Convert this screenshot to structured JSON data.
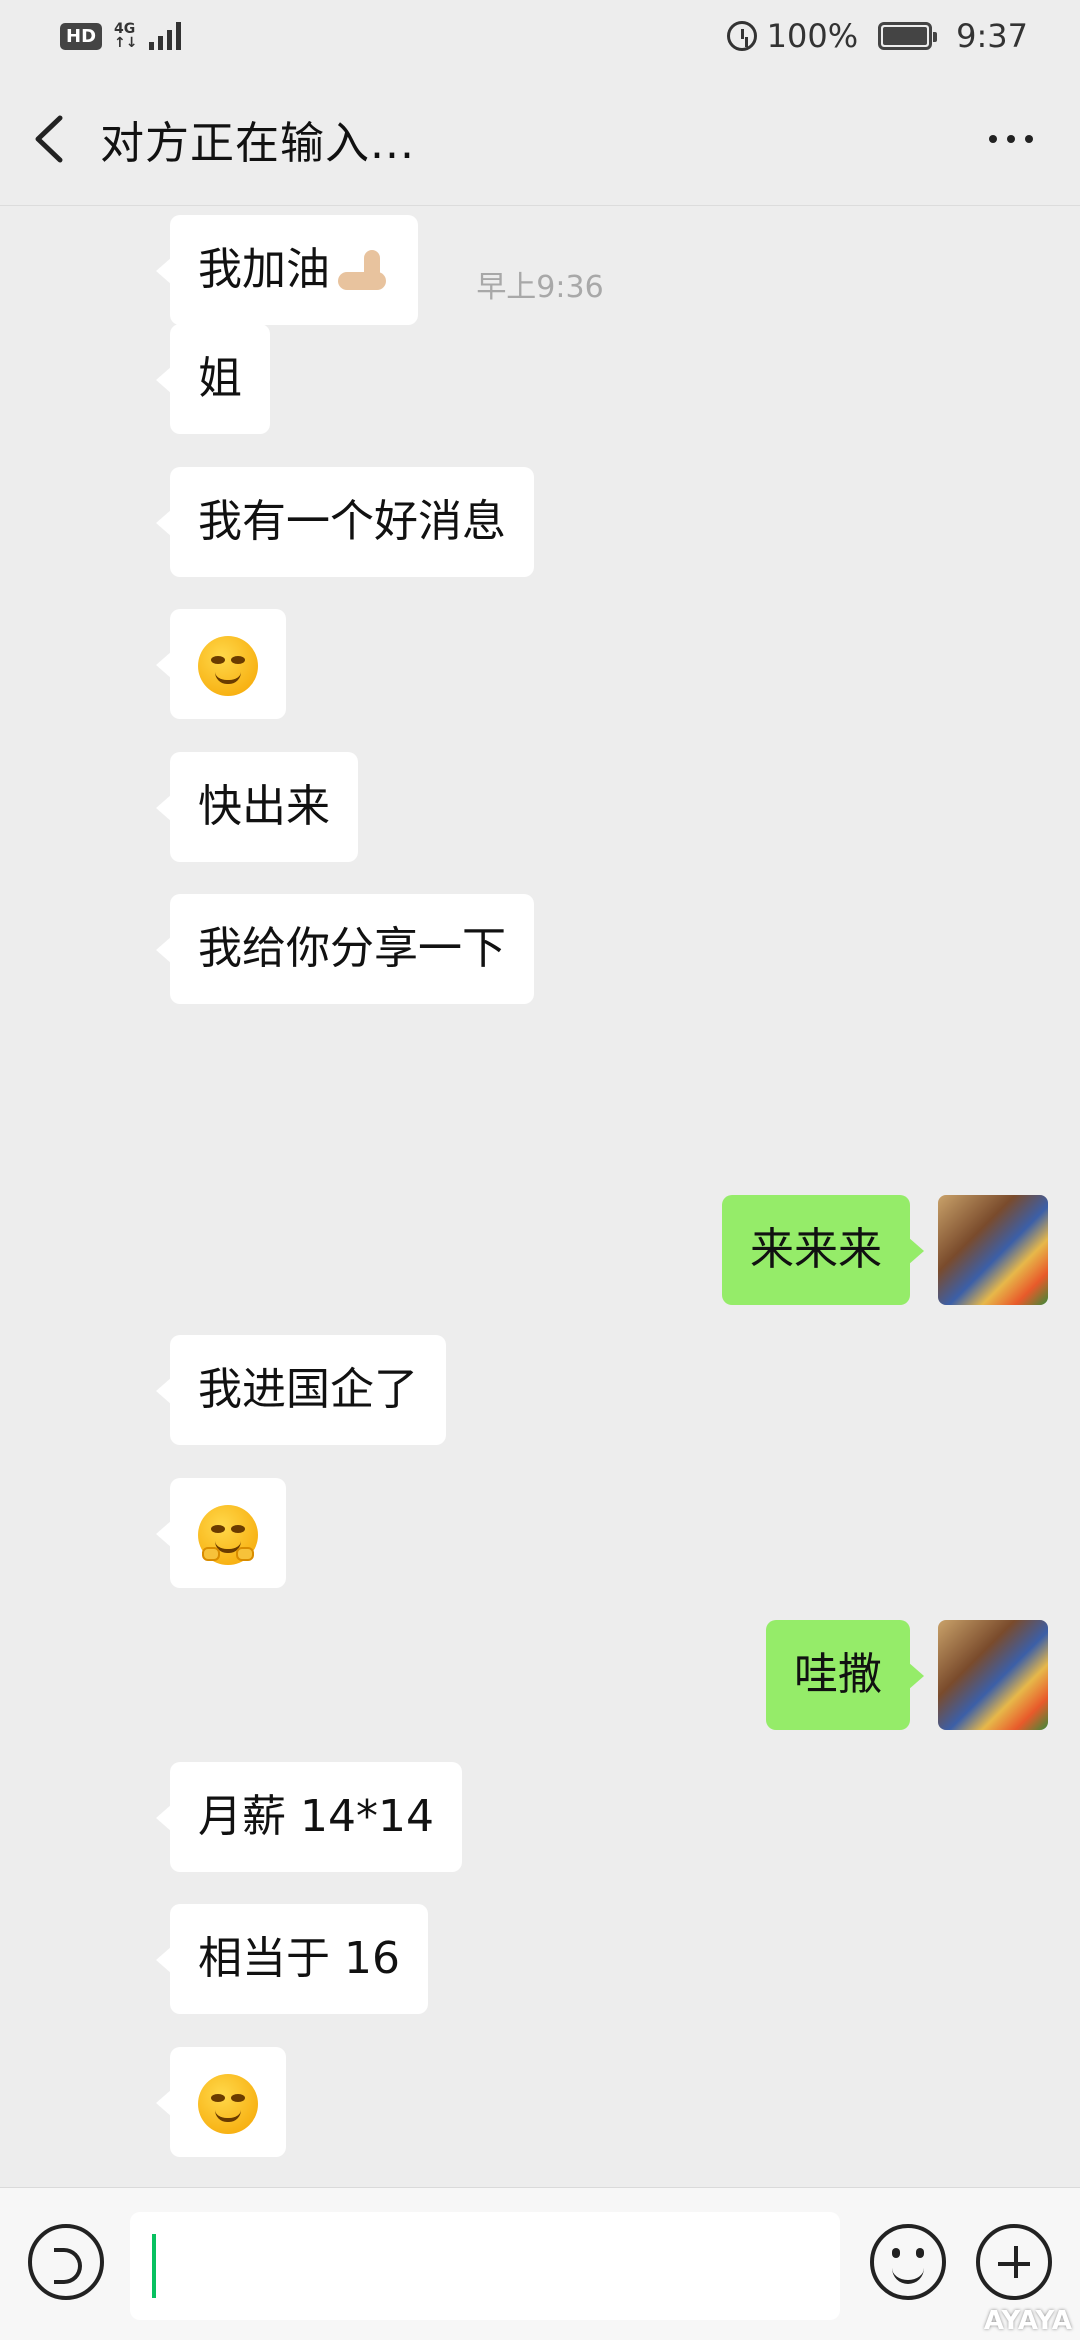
{
  "status_bar": {
    "hd": "HD",
    "network": "4G",
    "battery": "100%",
    "time": "9:37"
  },
  "header": {
    "title": "对方正在输入..."
  },
  "timestamp": "早上9:36",
  "messages": [
    {
      "side": "left",
      "text": "我加油",
      "emoji": "flexed-biceps"
    },
    {
      "side": "left",
      "text": "姐"
    },
    {
      "side": "left",
      "text": "我有一个好消息"
    },
    {
      "side": "left",
      "text": "",
      "emoji": "smirking-face"
    },
    {
      "side": "left",
      "text": "快出来"
    },
    {
      "side": "left",
      "text": "我给你分享一下"
    },
    {
      "side": "right",
      "text": "来来来"
    },
    {
      "side": "left",
      "text": "我进国企了"
    },
    {
      "side": "left",
      "text": "",
      "emoji": "hugging-face"
    },
    {
      "side": "right",
      "text": "哇撒"
    },
    {
      "side": "left",
      "text": "月薪 14*14"
    },
    {
      "side": "left",
      "text": "相当于 16"
    },
    {
      "side": "left",
      "text": "",
      "emoji": "smirking-face"
    }
  ],
  "input": {
    "value": ""
  },
  "watermark": "AYAYA",
  "colors": {
    "background": "#ededed",
    "bubble_left": "#ffffff",
    "bubble_right": "#95ec69",
    "caret": "#07c160"
  }
}
